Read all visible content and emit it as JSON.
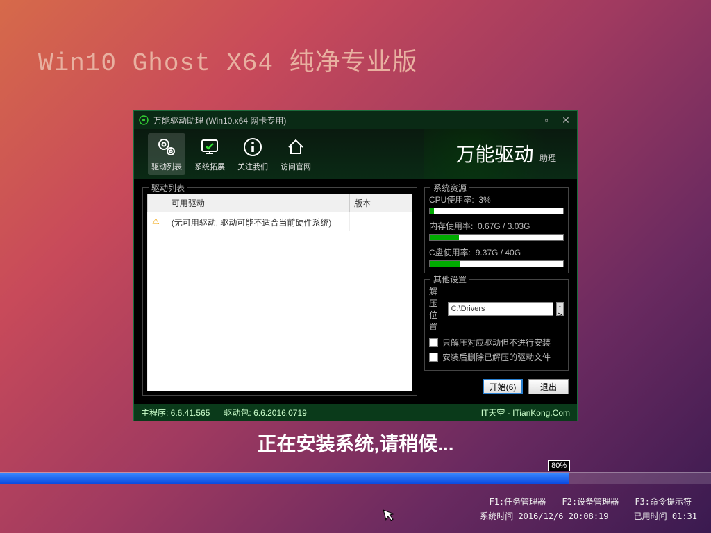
{
  "page": {
    "title": "Win10 Ghost X64 纯净专业版",
    "installing_message": "正在安装系统,请稍候...",
    "progress_percent": 80,
    "progress_label": "80%"
  },
  "window": {
    "title": "万能驱动助理 (Win10.x64 网卡专用)",
    "brand_main": "万能驱动",
    "brand_sub": "助理",
    "toolbar": [
      {
        "label": "驱动列表",
        "icon": "gear"
      },
      {
        "label": "系统拓展",
        "icon": "monitor"
      },
      {
        "label": "关注我们",
        "icon": "info"
      },
      {
        "label": "访问官网",
        "icon": "home"
      }
    ],
    "driver_list": {
      "title": "驱动列表",
      "col_driver": "可用驱动",
      "col_version": "版本",
      "empty_message": "(无可用驱动, 驱动可能不适合当前硬件系统)"
    },
    "resources": {
      "title": "系统资源",
      "items": [
        {
          "label": "CPU使用率:",
          "value": "3%",
          "fill": 3
        },
        {
          "label": "内存使用率:",
          "value": "0.67G / 3.03G",
          "fill": 22
        },
        {
          "label": "C盘使用率:",
          "value": "9.37G / 40G",
          "fill": 23
        }
      ]
    },
    "settings": {
      "title": "其他设置",
      "extract_label": "解压位置",
      "extract_path": "C:\\Drivers",
      "browse_label": "->",
      "check1": "只解压对应驱动但不进行安装",
      "check2": "安装后删除已解压的驱动文件"
    },
    "actions": {
      "start": "开始(6)",
      "exit": "退出"
    },
    "status": {
      "left_main": "主程序: 6.6.41.565",
      "left_driver": "驱动包: 6.6.2016.0719",
      "right": "IT天空 - ITianKong.Com"
    }
  },
  "footer": {
    "f1": "F1:任务管理器",
    "f2": "F2:设备管理器",
    "f3": "F3:命令提示符",
    "systime_label": "系统时间",
    "systime": "2016/12/6 20:08:19",
    "elapsed_label": "已用时间",
    "elapsed": "01:31"
  }
}
